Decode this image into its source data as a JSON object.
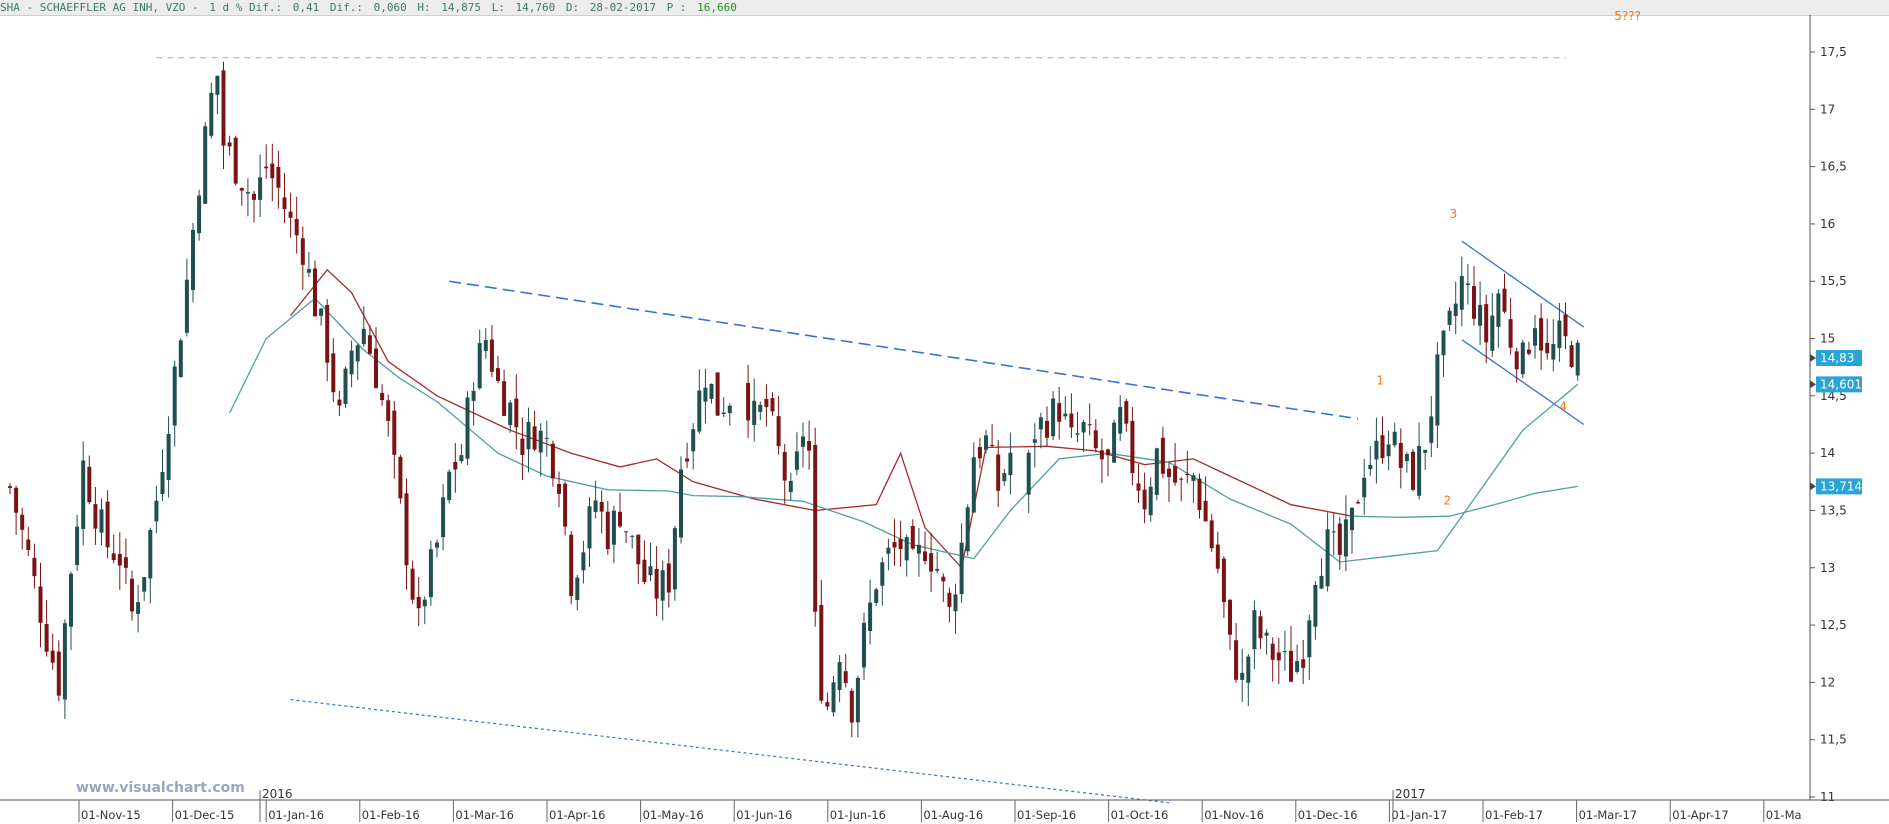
{
  "header": {
    "symbol": "SHA - SCHAEFFLER AG INH, VZO -",
    "period": "1 d % Dif.:",
    "pct_change": "0,41",
    "dif_label": "Dif.:",
    "dif_value": "0,060",
    "high_label": "H:",
    "high_value": "14,875",
    "low_label": "L:",
    "low_value": "14,760",
    "date_label": "D:",
    "date_value": "28-02-2017",
    "price_label": "P :",
    "price_value": "16,660"
  },
  "watermark": "www.visualchart.com",
  "colors": {
    "bull_candle": "#1f4f4f",
    "bear_candle": "#7a1414",
    "ma_short": "#a52a2a",
    "ma_long": "#4f9f9f",
    "trendline": "#3a6fd8",
    "annotation": "#f07a12",
    "price_label_bg": "#2aa4d6"
  },
  "chart_data": {
    "type": "candlestick",
    "title": "SHA - SCHAEFFLER AG INH, VZO",
    "ylim": [
      11,
      17.75
    ],
    "y_ticks": [
      "11",
      "11,5",
      "12",
      "12,5",
      "13",
      "13,5",
      "14",
      "14,5",
      "15",
      "15,5",
      "16",
      "16,5",
      "17",
      "17,5"
    ],
    "x_ticks": [
      "01-Nov-15",
      "01-Dec-15",
      "01-Jan-16",
      "01-Feb-16",
      "01-Mar-16",
      "01-Apr-16",
      "01-May-16",
      "01-Jun-16",
      "01-Jun-16",
      "01-Aug-16",
      "01-Sep-16",
      "01-Oct-16",
      "01-Nov-16",
      "01-Dec-16",
      "01-Jan-17",
      "01-Feb-17",
      "01-Mar-17",
      "01-Apr-17",
      "01-Ma"
    ],
    "year_labels": [
      "2016",
      "2017"
    ],
    "grid": false,
    "close_path": [
      [
        0,
        13.7
      ],
      [
        3,
        13.1
      ],
      [
        6,
        12.4
      ],
      [
        8,
        12.0
      ],
      [
        10,
        13.0
      ],
      [
        12,
        13.9
      ],
      [
        14,
        13.5
      ],
      [
        16,
        13.2
      ],
      [
        18,
        13.1
      ],
      [
        20,
        12.6
      ],
      [
        22,
        13.0
      ],
      [
        24,
        13.6
      ],
      [
        27,
        14.7
      ],
      [
        29,
        15.5
      ],
      [
        31,
        16.4
      ],
      [
        33,
        17.1
      ],
      [
        34,
        17.3
      ],
      [
        35,
        16.7
      ],
      [
        37,
        16.5
      ],
      [
        40,
        16.2
      ],
      [
        42,
        16.5
      ],
      [
        44,
        16.3
      ],
      [
        46,
        16.0
      ],
      [
        48,
        15.8
      ],
      [
        50,
        15.3
      ],
      [
        52,
        14.9
      ],
      [
        54,
        14.3
      ],
      [
        56,
        14.9
      ],
      [
        58,
        15.1
      ],
      [
        60,
        14.7
      ],
      [
        62,
        14.2
      ],
      [
        64,
        13.5
      ],
      [
        66,
        12.8
      ],
      [
        67,
        12.5
      ],
      [
        68,
        12.8
      ],
      [
        70,
        13.2
      ],
      [
        72,
        13.8
      ],
      [
        74,
        14.0
      ],
      [
        76,
        14.7
      ],
      [
        78,
        15.0
      ],
      [
        80,
        14.6
      ],
      [
        82,
        14.4
      ],
      [
        84,
        14.1
      ],
      [
        86,
        14.2
      ],
      [
        88,
        14.1
      ],
      [
        90,
        13.8
      ],
      [
        92,
        12.9
      ],
      [
        94,
        13.2
      ],
      [
        96,
        13.6
      ],
      [
        98,
        13.3
      ],
      [
        100,
        13.5
      ],
      [
        102,
        13.2
      ],
      [
        104,
        12.9
      ],
      [
        106,
        12.8
      ],
      [
        108,
        12.9
      ],
      [
        110,
        13.9
      ],
      [
        112,
        14.3
      ],
      [
        114,
        14.7
      ],
      [
        116,
        14.4
      ],
      [
        118,
        14.5
      ],
      [
        120,
        14.6
      ],
      [
        122,
        14.3
      ],
      [
        124,
        14.4
      ],
      [
        126,
        14.0
      ],
      [
        128,
        13.6
      ],
      [
        130,
        14.2
      ],
      [
        131,
        14.0
      ],
      [
        132,
        12.5
      ],
      [
        133,
        12.0
      ],
      [
        134,
        11.8
      ],
      [
        136,
        12.3
      ],
      [
        138,
        11.8
      ],
      [
        140,
        12.4
      ],
      [
        142,
        12.9
      ],
      [
        144,
        13.1
      ],
      [
        146,
        13.2
      ],
      [
        148,
        13.0
      ],
      [
        150,
        13.2
      ],
      [
        152,
        13.0
      ],
      [
        154,
        12.6
      ],
      [
        156,
        13.2
      ],
      [
        158,
        14.0
      ],
      [
        160,
        14.1
      ],
      [
        162,
        13.7
      ],
      [
        164,
        14.0
      ],
      [
        166,
        13.6
      ],
      [
        168,
        14.2
      ],
      [
        170,
        14.3
      ],
      [
        172,
        14.4
      ],
      [
        174,
        14.1
      ],
      [
        176,
        14.2
      ],
      [
        178,
        14.0
      ],
      [
        180,
        13.9
      ],
      [
        182,
        14.3
      ],
      [
        184,
        13.9
      ],
      [
        186,
        13.6
      ],
      [
        188,
        14.0
      ],
      [
        190,
        13.8
      ],
      [
        192,
        13.7
      ],
      [
        194,
        13.8
      ],
      [
        196,
        13.4
      ],
      [
        198,
        13.0
      ],
      [
        200,
        12.3
      ],
      [
        202,
        12.0
      ],
      [
        204,
        12.5
      ],
      [
        206,
        12.3
      ],
      [
        208,
        12.2
      ],
      [
        210,
        12.1
      ],
      [
        212,
        12.3
      ],
      [
        214,
        13.0
      ],
      [
        216,
        13.2
      ],
      [
        218,
        13.1
      ],
      [
        220,
        13.4
      ],
      [
        222,
        13.9
      ],
      [
        224,
        14.0
      ],
      [
        226,
        14.2
      ],
      [
        228,
        13.9
      ],
      [
        230,
        13.8
      ],
      [
        232,
        14.1
      ],
      [
        234,
        14.7
      ],
      [
        236,
        15.1
      ],
      [
        238,
        15.5
      ],
      [
        240,
        15.3
      ],
      [
        242,
        15.0
      ],
      [
        244,
        15.4
      ],
      [
        246,
        15.0
      ],
      [
        248,
        14.8
      ],
      [
        250,
        15.2
      ],
      [
        252,
        14.8
      ],
      [
        254,
        15.0
      ],
      [
        256,
        14.9
      ],
      [
        257,
        14.83
      ]
    ],
    "ma_short_path": [
      [
        46,
        15.2
      ],
      [
        52,
        15.6
      ],
      [
        56,
        15.4
      ],
      [
        62,
        14.8
      ],
      [
        70,
        14.5
      ],
      [
        82,
        14.2
      ],
      [
        92,
        14.0
      ],
      [
        100,
        13.88
      ],
      [
        106,
        13.95
      ],
      [
        112,
        13.75
      ],
      [
        122,
        13.6
      ],
      [
        132,
        13.5
      ],
      [
        142,
        13.55
      ],
      [
        150,
        13.35
      ],
      [
        156,
        13.0
      ],
      [
        146,
        14.0
      ],
      [
        160,
        14.05
      ],
      [
        170,
        14.06
      ],
      [
        178,
        14.02
      ],
      [
        186,
        13.9
      ],
      [
        194,
        13.95
      ],
      [
        200,
        13.8
      ],
      [
        210,
        13.55
      ],
      [
        220,
        13.45
      ]
    ],
    "ma_long_path": [
      [
        36,
        14.35
      ],
      [
        42,
        15.0
      ],
      [
        50,
        15.35
      ],
      [
        58,
        14.9
      ],
      [
        64,
        14.65
      ],
      [
        70,
        14.45
      ],
      [
        80,
        14.0
      ],
      [
        88,
        13.8
      ],
      [
        98,
        13.68
      ],
      [
        108,
        13.67
      ],
      [
        112,
        13.63
      ],
      [
        120,
        13.62
      ],
      [
        130,
        13.58
      ],
      [
        140,
        13.4
      ],
      [
        148,
        13.2
      ],
      [
        158,
        13.08
      ],
      [
        164,
        13.5
      ],
      [
        172,
        13.95
      ],
      [
        180,
        14.0
      ],
      [
        190,
        13.92
      ],
      [
        200,
        13.6
      ],
      [
        210,
        13.38
      ],
      [
        218,
        13.05
      ],
      [
        226,
        13.1
      ],
      [
        234,
        13.15
      ],
      [
        240,
        13.6
      ],
      [
        248,
        14.2
      ],
      [
        257,
        14.6
      ]
    ],
    "ma_third_path": [
      [
        220,
        13.45
      ],
      [
        228,
        13.44
      ],
      [
        236,
        13.45
      ],
      [
        244,
        13.56
      ],
      [
        250,
        13.65
      ],
      [
        257,
        13.71
      ]
    ],
    "trendlines": [
      {
        "style": "dashed",
        "from": [
          72,
          15.5
        ],
        "to": [
          221,
          14.3
        ]
      },
      {
        "style": "dotted",
        "from": [
          46,
          11.85
        ],
        "to": [
          190,
          10.95
        ]
      },
      {
        "style": "solid",
        "from": [
          238,
          15.85
        ],
        "to": [
          258,
          15.1
        ]
      },
      {
        "style": "solid",
        "from": [
          238,
          14.99
        ],
        "to": [
          258,
          14.25
        ]
      },
      {
        "style": "gray-dashed",
        "from": [
          24,
          17.45
        ],
        "to": [
          255,
          17.45
        ]
      }
    ],
    "annotations": [
      {
        "text": "5???",
        "x": 263,
        "y": 17.78
      },
      {
        "text": "3",
        "x": 236,
        "y": 16.05
      },
      {
        "text": "1",
        "x": 224,
        "y": 14.6
      },
      {
        "text": "2",
        "x": 235,
        "y": 13.55
      },
      {
        "text": "4",
        "x": 254,
        "y": 14.37
      }
    ],
    "price_labels": [
      {
        "text": "14,83",
        "value": 14.83
      },
      {
        "text": "14,601",
        "value": 14.6
      },
      {
        "text": "13,714",
        "value": 13.71
      }
    ]
  }
}
